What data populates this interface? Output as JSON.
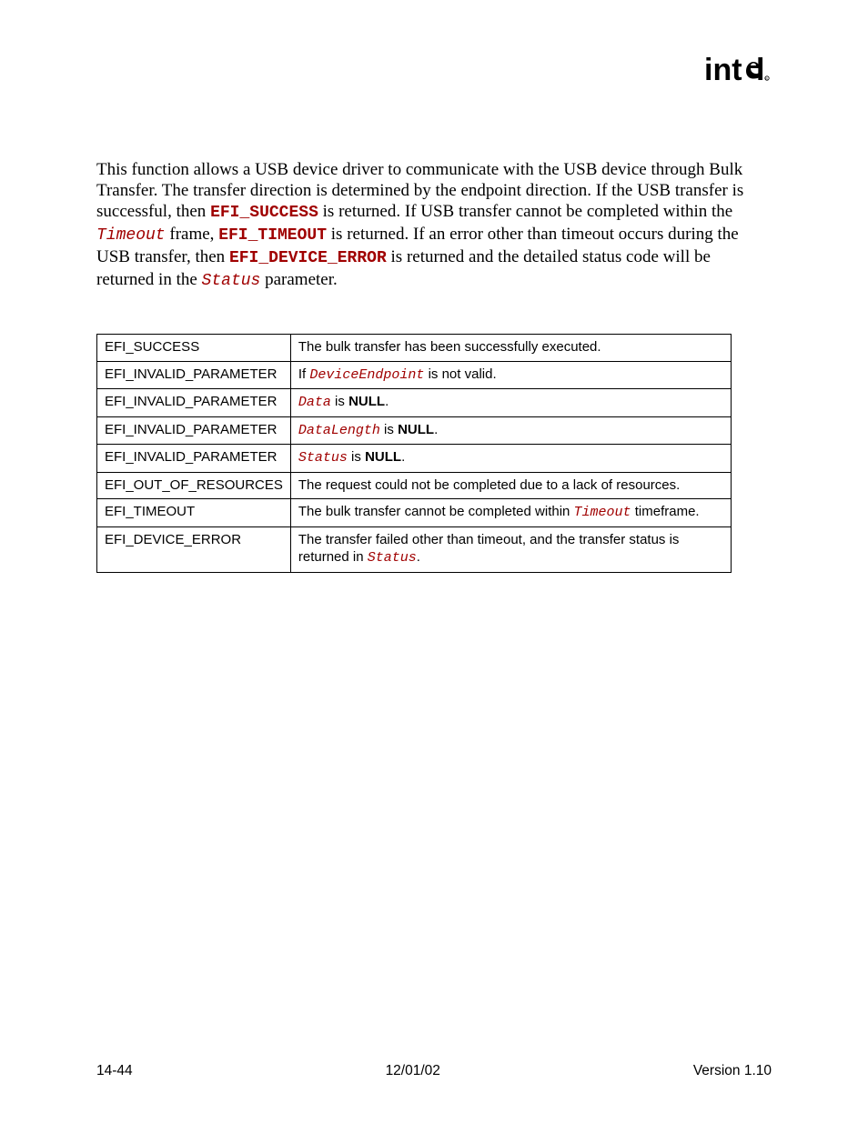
{
  "logo_alt": "intel",
  "paragraph": {
    "p1_a": "This function allows a USB device driver to communicate with the USB device through Bulk Transfer.  The transfer direction is determined by the endpoint direction.  If the USB transfer is successful, then ",
    "p1_code1": "EFI_SUCCESS",
    "p1_b": " is returned.  If USB transfer cannot be completed within the ",
    "p1_code2": "Timeout",
    "p1_c": " frame, ",
    "p1_code3": "EFI_TIMEOUT",
    "p1_d": " is returned.  If an error other than timeout occurs during the USB transfer, then ",
    "p1_code4": "EFI_DEVICE_ERROR",
    "p1_e": " is returned and the detailed status code will be returned in the ",
    "p1_code5": "Status",
    "p1_f": " parameter."
  },
  "table_rows": [
    {
      "code": "EFI_SUCCESS",
      "desc_a": "The bulk transfer has been successfully executed."
    },
    {
      "code": "EFI_INVALID_PARAMETER",
      "desc_a": "If ",
      "param": "DeviceEndpoint",
      "desc_b": " is not valid."
    },
    {
      "code": "EFI_INVALID_PARAMETER",
      "param": "Data",
      "desc_b": " is ",
      "bold": "NULL",
      "desc_c": "."
    },
    {
      "code": "EFI_INVALID_PARAMETER",
      "param": "DataLength",
      "desc_b": " is ",
      "bold": "NULL",
      "desc_c": "."
    },
    {
      "code": "EFI_INVALID_PARAMETER",
      "param": "Status",
      "desc_b": " is ",
      "bold": "NULL",
      "desc_c": "."
    },
    {
      "code": "EFI_OUT_OF_RESOURCES",
      "desc_a": "The request could not be completed due to a lack of resources."
    },
    {
      "code": "EFI_TIMEOUT",
      "desc_a": "The bulk transfer cannot be completed within ",
      "param": "Timeout",
      "desc_b": " timeframe."
    },
    {
      "code": "EFI_DEVICE_ERROR",
      "desc_a": "The transfer failed other than timeout, and the transfer status is returned in ",
      "param": "Status",
      "desc_c": "."
    }
  ],
  "footer": {
    "left": "14-44",
    "center": "12/01/02",
    "right": "Version 1.10"
  }
}
